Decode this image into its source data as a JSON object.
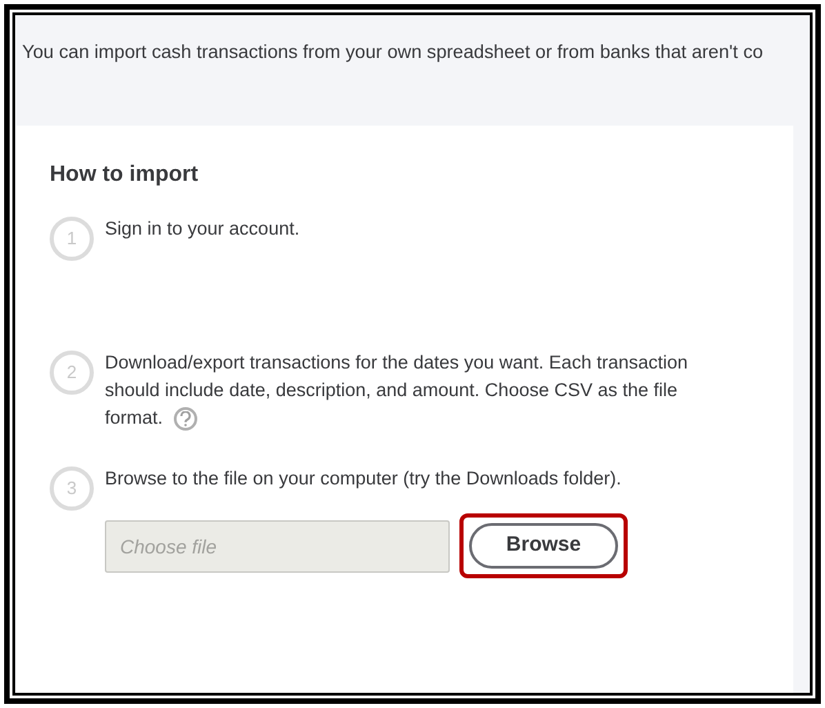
{
  "intro": "You can import cash transactions from your own spreadsheet or from banks that aren't co",
  "heading": "How to import",
  "steps": [
    {
      "number": "1",
      "text": "Sign in to your account.",
      "help": false
    },
    {
      "number": "2",
      "text": "Download/export transactions for the dates you want. Each transaction should include date, description, and amount. Choose CSV as the file format.",
      "help": true
    },
    {
      "number": "3",
      "text": "Browse to the file on your computer (try the Downloads folder).",
      "help": false
    }
  ],
  "file_field": {
    "placeholder": "Choose file"
  },
  "browse_button": {
    "label": "Browse",
    "highlighted": true
  }
}
